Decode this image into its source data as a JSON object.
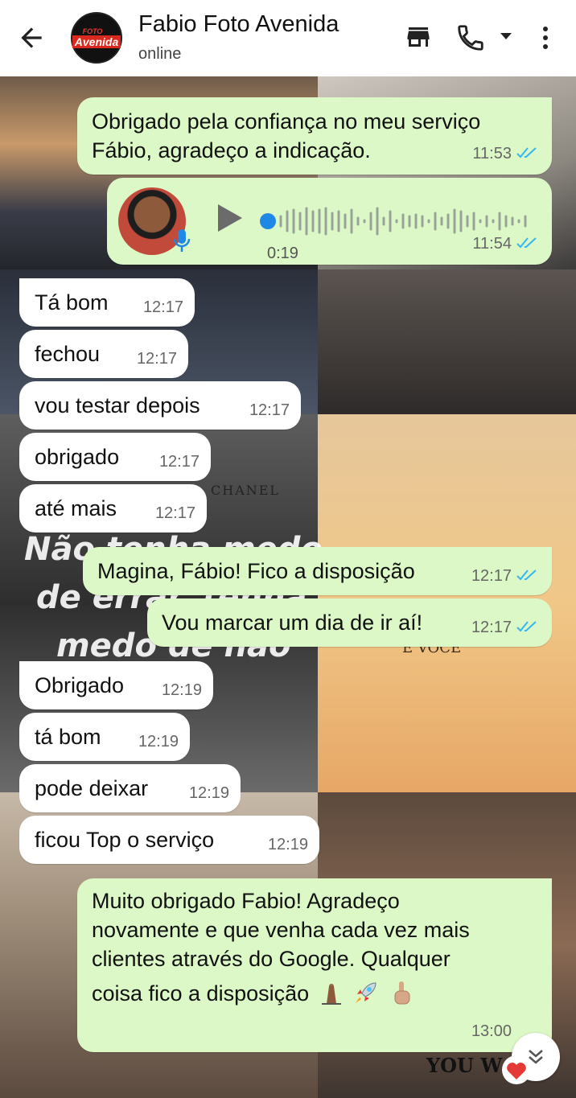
{
  "header": {
    "contact_name": "Fabio Foto Avenida",
    "status": "online",
    "avatar_line1": "FOTO",
    "avatar_line2": "Avenida"
  },
  "wallpaper": {
    "text_lines": [
      "Não tenha medo",
      "de errar, tenha",
      "medo de não"
    ],
    "label_chanel": "CHANEL",
    "label_voce": "E VOCE",
    "label_you": "YOU W"
  },
  "messages": [
    {
      "dir": "out",
      "lines": [
        "Obrigado pela confiança no meu serviço",
        "Fábio, agradeço a indicação."
      ],
      "time": "11:53",
      "read": true
    },
    {
      "dir": "out",
      "type": "audio",
      "duration": "0:19",
      "time": "11:54",
      "read": true
    },
    {
      "dir": "in",
      "text": "Tá bom",
      "time": "12:17"
    },
    {
      "dir": "in",
      "text": "fechou",
      "time": "12:17"
    },
    {
      "dir": "in",
      "text": "vou testar depois",
      "time": "12:17"
    },
    {
      "dir": "in",
      "text": "obrigado",
      "time": "12:17"
    },
    {
      "dir": "in",
      "text": "até mais",
      "time": "12:17"
    },
    {
      "dir": "out",
      "text": "Magina, Fábio! Fico a disposição",
      "time": "12:17",
      "read": true
    },
    {
      "dir": "out",
      "text": "Vou marcar um dia de ir aí!",
      "time": "12:17",
      "read": true
    },
    {
      "dir": "in",
      "text": "Obrigado",
      "time": "12:19"
    },
    {
      "dir": "in",
      "text": "tá bom",
      "time": "12:19"
    },
    {
      "dir": "in",
      "text": "pode deixar",
      "time": "12:19"
    },
    {
      "dir": "in",
      "text": "ficou Top o serviço",
      "time": "12:19"
    },
    {
      "dir": "out",
      "lines": [
        "Muito obrigado Fabio! Agradeço",
        "novamente e que venha cada vez mais",
        "clientes através do Google. Qualquer",
        "coisa fico a disposição"
      ],
      "emojis": [
        "folded-hands",
        "rocket",
        "pointing-up"
      ],
      "time": "13:00",
      "read": true
    }
  ],
  "colors": {
    "outgoing_bubble": "#dcf8c6",
    "incoming_bubble": "#ffffff",
    "read_ticks": "#34b7f1",
    "audio_dot": "#1e88e5"
  }
}
